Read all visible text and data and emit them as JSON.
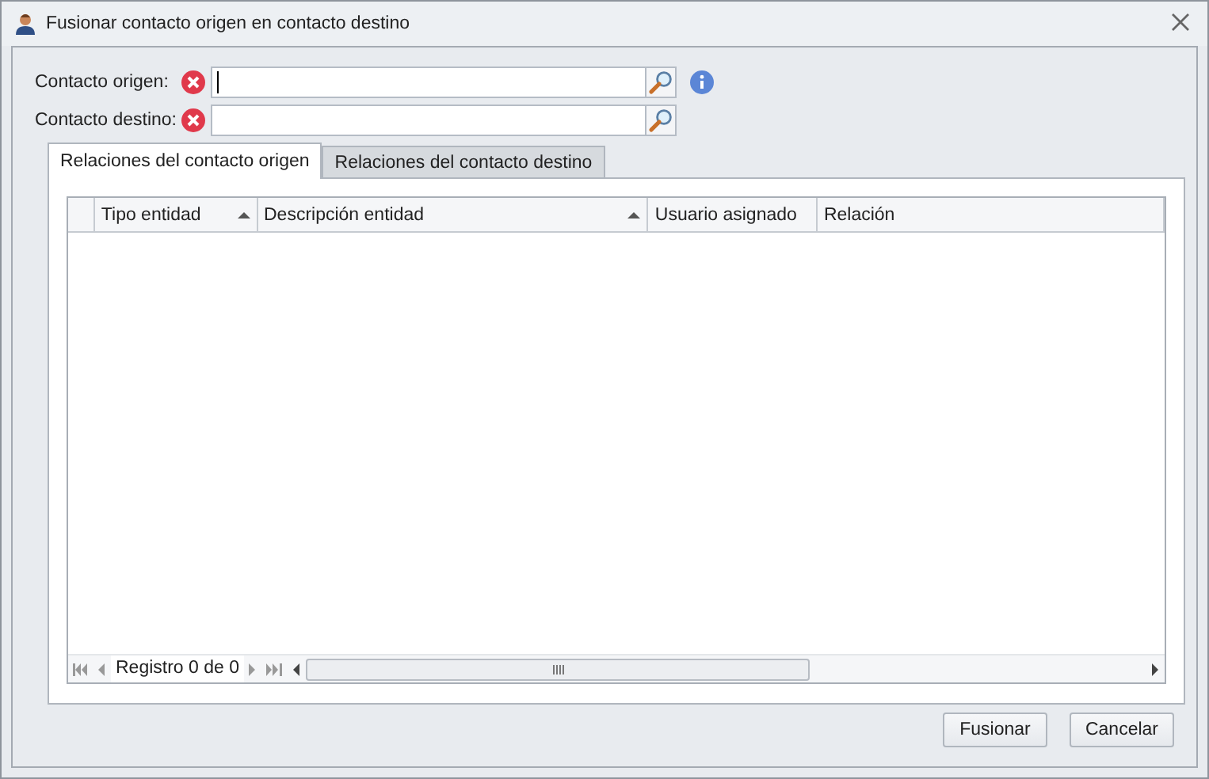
{
  "window": {
    "title": "Fusionar contacto origen en contacto destino"
  },
  "fields": [
    {
      "label": "Contacto origen:",
      "error": true,
      "focused": true,
      "info": true
    },
    {
      "label": "Contacto destino:",
      "error": true,
      "focused": false,
      "info": false
    }
  ],
  "tabs": [
    {
      "label": "Relaciones del contacto origen",
      "selected": true
    },
    {
      "label": "Relaciones del contacto destino",
      "selected": false
    }
  ],
  "table": {
    "columns": [
      {
        "label": "Tipo entidad",
        "sorted": true
      },
      {
        "label": "Descripción entidad",
        "sorted": true
      },
      {
        "label": "Usuario asignado",
        "sorted": false
      },
      {
        "label": "Relación",
        "sorted": false
      }
    ],
    "navigator": "Registro 0 de 0"
  },
  "buttons": [
    "Fusionar",
    "Cancelar"
  ]
}
